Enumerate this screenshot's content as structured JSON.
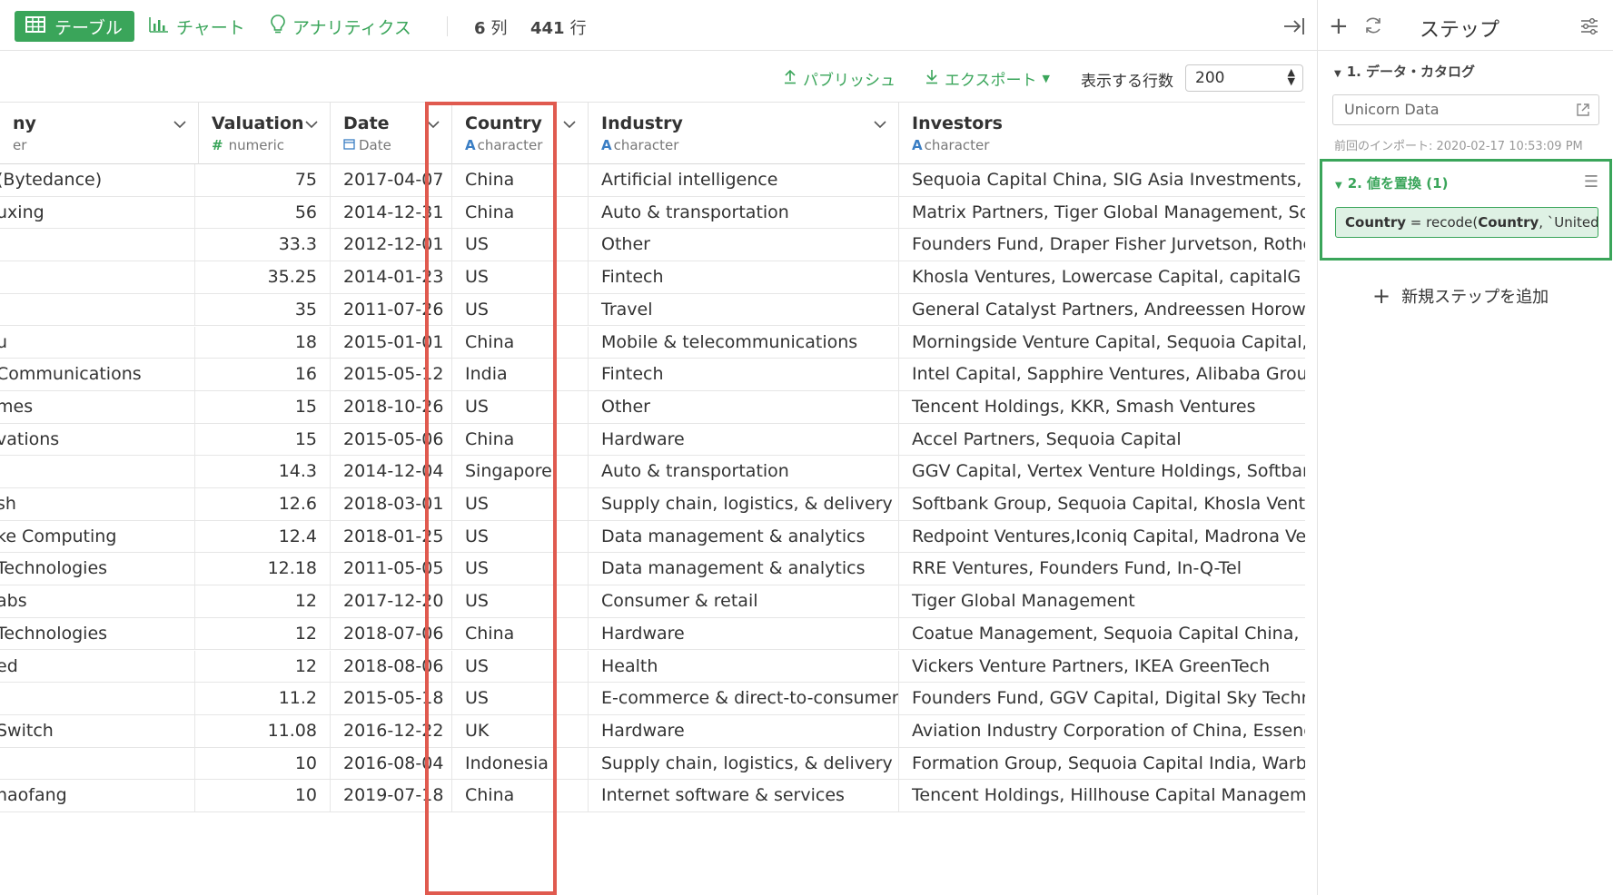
{
  "toolbar": {
    "tab_table": "テーブル",
    "tab_chart": "チャート",
    "tab_analytics": "アナリティクス",
    "columns_count": "6",
    "columns_unit": "列",
    "rows_count": "441",
    "rows_unit": "行"
  },
  "subbar": {
    "publish": "パブリッシュ",
    "export": "エクスポート",
    "rows_label": "表示する行数",
    "rows_value": "200"
  },
  "columns": [
    {
      "name": "ny",
      "type": "er",
      "type_icon": ""
    },
    {
      "name": "Valuation",
      "type": "numeric",
      "type_icon": "#"
    },
    {
      "name": "Date",
      "type": "Date",
      "type_icon": "calendar"
    },
    {
      "name": "Country",
      "type": "character",
      "type_icon": "A"
    },
    {
      "name": "Industry",
      "type": "character",
      "type_icon": "A"
    },
    {
      "name": "Investors",
      "type": "character",
      "type_icon": "A"
    }
  ],
  "rows": [
    [
      "(Bytedance)",
      "75",
      "2017-04-07",
      "China",
      "Artificial intelligence",
      "Sequoia Capital China, SIG Asia Investments, Sina Weibo,"
    ],
    [
      "uxing",
      "56",
      "2014-12-31",
      "China",
      "Auto & transportation",
      "Matrix Partners, Tiger Global Management, Softbank Corp"
    ],
    [
      "",
      "33.3",
      "2012-12-01",
      "US",
      "Other",
      "Founders Fund, Draper Fisher Jurvetson, Rothenberg Vent"
    ],
    [
      "",
      "35.25",
      "2014-01-23",
      "US",
      "Fintech",
      "Khosla Ventures, Lowercase Capital, capitalG"
    ],
    [
      "",
      "35",
      "2011-07-26",
      "US",
      "Travel",
      "General Catalyst Partners, Andreessen Horowitz, ENIAC Ve"
    ],
    [
      "u",
      "18",
      "2015-01-01",
      "China",
      "Mobile & telecommunications",
      "Morningside Venture Capital, Sequoia Capital, Baidu"
    ],
    [
      "Communications",
      "16",
      "2015-05-12",
      "India",
      "Fintech",
      "Intel Capital, Sapphire Ventures, Alibaba Group"
    ],
    [
      "mes",
      "15",
      "2018-10-26",
      "US",
      "Other",
      "Tencent Holdings, KKR, Smash Ventures"
    ],
    [
      "vations",
      "15",
      "2015-05-06",
      "China",
      "Hardware",
      "Accel Partners, Sequoia Capital"
    ],
    [
      "",
      "14.3",
      "2014-12-04",
      "Singapore",
      "Auto & transportation",
      "GGV Capital, Vertex Venture Holdings, Softbank Group"
    ],
    [
      "sh",
      "12.6",
      "2018-03-01",
      "US",
      "Supply chain, logistics, & delivery",
      "Softbank Group, Sequoia Capital, Khosla Ventures"
    ],
    [
      "ke Computing",
      "12.4",
      "2018-01-25",
      "US",
      "Data management & analytics",
      "Redpoint Ventures,Iconiq Capital, Madrona Venture Group"
    ],
    [
      "Technologies",
      "12.18",
      "2011-05-05",
      "US",
      "Data management & analytics",
      "RRE Ventures, Founders Fund, In-Q-Tel"
    ],
    [
      "abs",
      "12",
      "2017-12-20",
      "US",
      "Consumer & retail",
      "Tiger Global Management"
    ],
    [
      "Technologies",
      "12",
      "2018-07-06",
      "China",
      "Hardware",
      "Coatue Management, Sequoia Capital China, IDG Capital"
    ],
    [
      "ed",
      "12",
      "2018-08-06",
      "US",
      "Health",
      "Vickers Venture Partners, IKEA GreenTech"
    ],
    [
      "",
      "11.2",
      "2015-05-18",
      "US",
      "E-commerce & direct-to-consumer",
      "Founders Fund, GGV Capital, Digital Sky Technologies"
    ],
    [
      "Switch",
      "11.08",
      "2016-12-22",
      "UK",
      "Hardware",
      "Aviation Industry Corporation of China, Essence Financial,"
    ],
    [
      "",
      "10",
      "2016-08-04",
      "Indonesia",
      "Supply chain, logistics, & delivery",
      "Formation Group, Sequoia Capital India, Warburg Pincus"
    ],
    [
      "haofang",
      "10",
      "2019-07-18",
      "China",
      "Internet software & services",
      "Tencent Holdings, Hillhouse Capital Management, Source"
    ]
  ],
  "panel": {
    "title": "ステップ",
    "step1_title": "1. データ・カタログ",
    "source_name": "Unicorn Data",
    "import_note": "前回のインポート: 2020-02-17 10:53:09 PM",
    "step2_title": "2. 値を置換 (1)",
    "formula_lhs": "Country",
    "formula_eq": " = recode(",
    "formula_arg": "Country",
    "formula_rest": ", `United…",
    "add_step": "新規ステップを追加"
  },
  "colors": {
    "accent": "#3aa55a",
    "highlight": "#e05a4f",
    "type_blue": "#3a7ec4"
  }
}
